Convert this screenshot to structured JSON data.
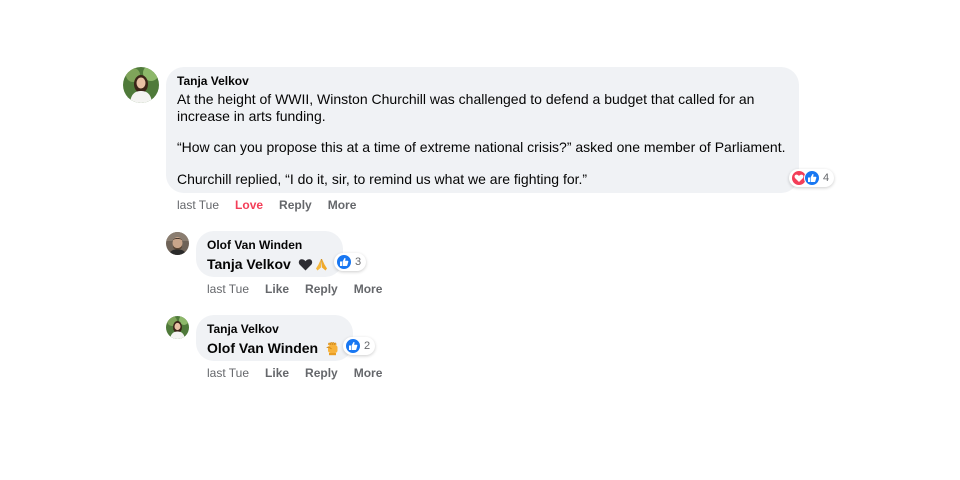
{
  "colors": {
    "bubble_bg": "#f0f2f5",
    "like_blue": "#1877f2",
    "love_red": "#f33e58",
    "meta_gray": "#65676b",
    "text": "#050505"
  },
  "comments": [
    {
      "author": "Tanja Velkov",
      "paragraphs": [
        "At the height of WWII, Winston Churchill was challenged to defend a budget that called for an increase in arts funding.",
        "“How can you propose this at a time of extreme national crisis?” asked one member of Parliament.",
        "Churchill replied, “I do it, sir, to remind us what we are fighting for.”"
      ],
      "reaction_icons": [
        "love-icon",
        "like-icon"
      ],
      "reaction_count": "4",
      "actions": {
        "time": "last Tue",
        "reaction": "Love",
        "reply": "Reply",
        "more": "More"
      }
    },
    {
      "author": "Olof Van Winden",
      "mention": "Tanja Velkov",
      "emojis": [
        "black-heart-icon",
        "folded-hands-icon"
      ],
      "reaction_icons": [
        "like-icon"
      ],
      "reaction_count": "3",
      "actions": {
        "time": "last Tue",
        "reaction": "Like",
        "reply": "Reply",
        "more": "More"
      }
    },
    {
      "author": "Tanja Velkov",
      "mention": "Olof Van Winden",
      "emojis": [
        "raised-fist-icon"
      ],
      "reaction_icons": [
        "like-icon"
      ],
      "reaction_count": "2",
      "actions": {
        "time": "last Tue",
        "reaction": "Like",
        "reply": "Reply",
        "more": "More"
      }
    }
  ]
}
